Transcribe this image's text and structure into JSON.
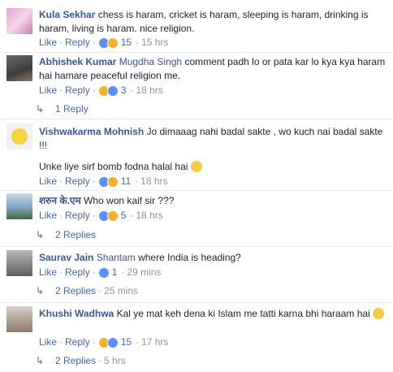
{
  "actions": {
    "like": "Like",
    "reply": "Reply",
    "sep": "·"
  },
  "colors": {
    "link": "#4267b2",
    "name": "#365899",
    "meta": "#90949c"
  },
  "comments": [
    {
      "name": "Kula Sekhar",
      "text": "chess is haram, cricket is haram, sleeping is haram, drinking is haram, living is haram. nice religion.",
      "reactions": [
        "like-icon",
        "haha-icon"
      ],
      "count": "15",
      "time": "15 hrs"
    },
    {
      "name": "Abhishek Kumar",
      "tag": "Mugdha Singh",
      "text": "comment padh lo or pata kar lo kya kya haram hai hamare peaceful religion me.",
      "reactions": [
        "haha-icon",
        "like-icon"
      ],
      "count": "3",
      "time": "18 hrs",
      "replies": "1 Reply"
    },
    {
      "name": "Vishwakarma Mohnish",
      "text": "Jo dimaaag nahi badal sakte , wo kuch nai badal sakte !!!",
      "text2": "Unke liye sirf bomb fodna halal hai",
      "emoji": "grin-emoji",
      "reactions": [
        "like-icon",
        "haha-icon"
      ],
      "count": "11",
      "time": "18 hrs"
    },
    {
      "name": "शरुन के.एम",
      "text": "Who won kaif sir ???",
      "reactions": [
        "like-icon",
        "haha-icon"
      ],
      "count": "5",
      "time": "18 hrs",
      "replies": "2 Replies"
    },
    {
      "name": "Saurav Jain",
      "tag": "Shantam",
      "text": "where India is heading?",
      "reactions": [
        "like-icon"
      ],
      "count": "1",
      "time": "29 mins",
      "replies": "2 Replies",
      "replies_time": "25 mins"
    },
    {
      "name": "Khushi Wadhwa",
      "text": "Kal ye mat keh dena ki Islam me tatti karna bhi haraam hai",
      "emoji": "unamused-emoji",
      "reactions": [
        "haha-icon",
        "like-icon"
      ],
      "count": "15",
      "time": "17 hrs",
      "replies": "2 Replies",
      "replies_time": "5 hrs"
    }
  ]
}
